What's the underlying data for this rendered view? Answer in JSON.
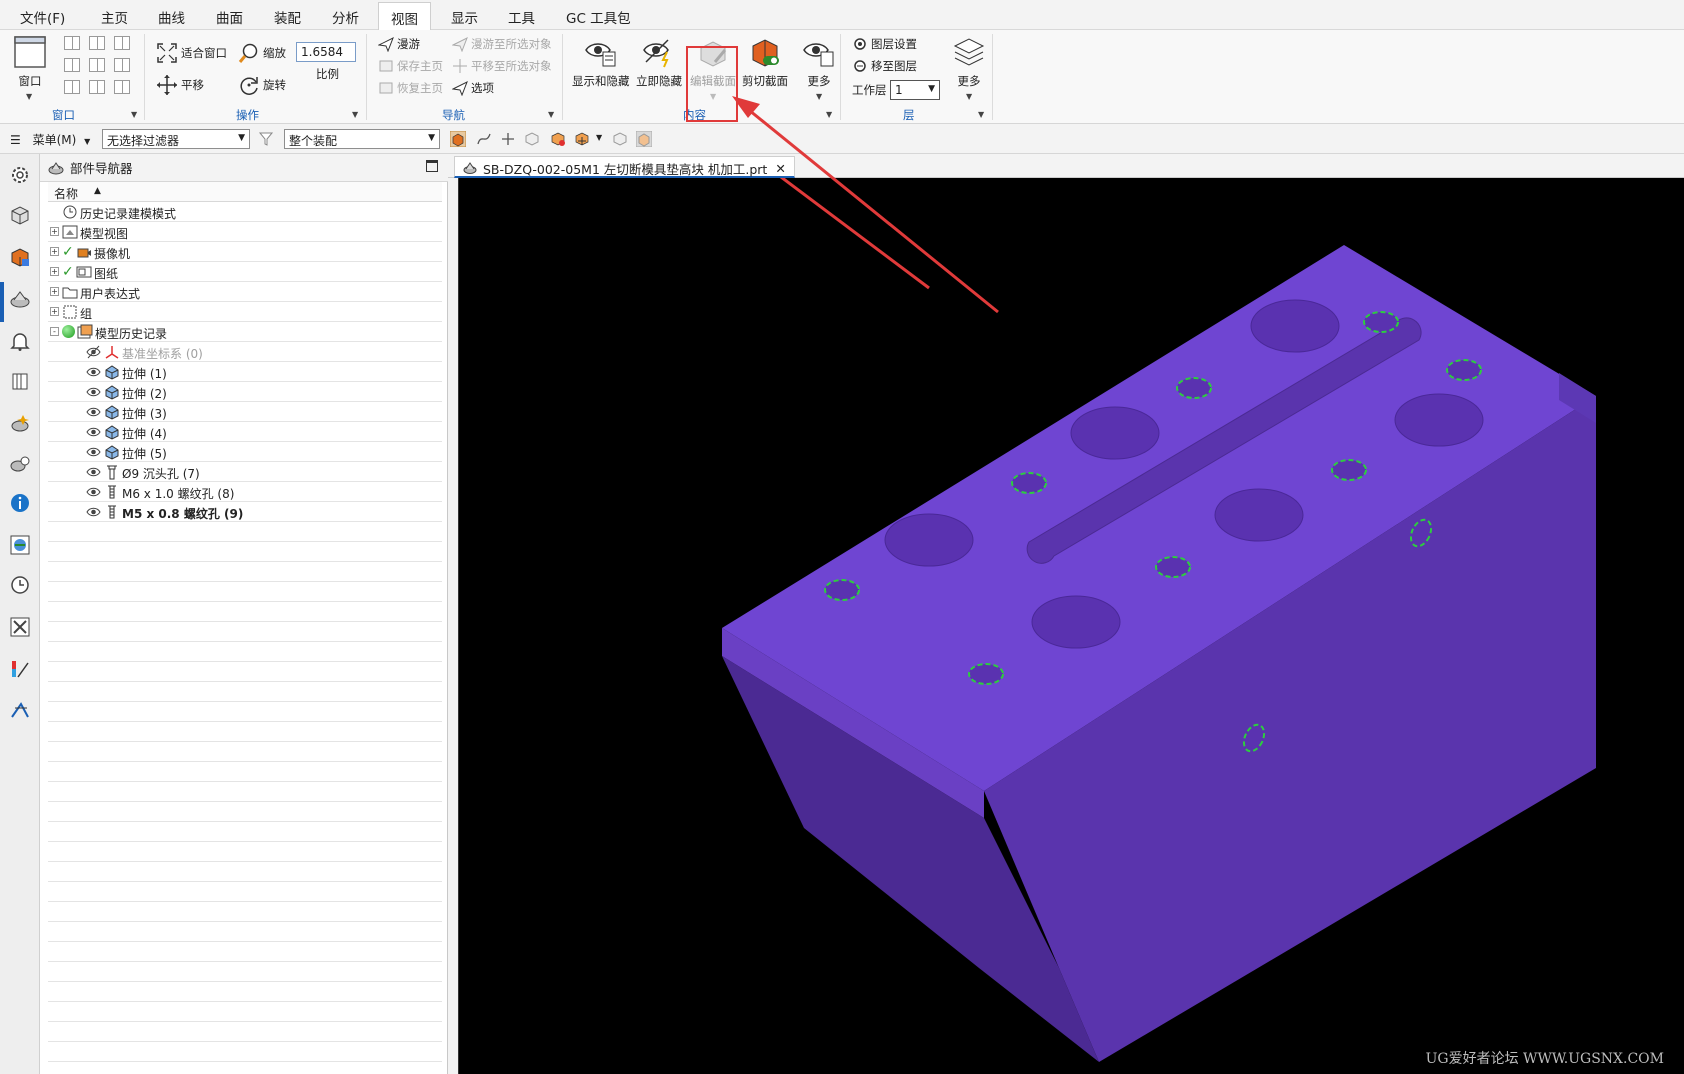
{
  "menu": {
    "tabs": [
      "文件(F)",
      "主页",
      "曲线",
      "曲面",
      "装配",
      "分析",
      "视图",
      "显示",
      "工具",
      "GC 工具包"
    ],
    "active_tab": "视图"
  },
  "ribbon": {
    "window_group": {
      "label": "窗口",
      "big_button": "窗口"
    },
    "operation_group": {
      "label": "操作",
      "fit_window": "适合窗口",
      "zoom": "缩放",
      "pan": "平移",
      "rotate": "旋转",
      "scale_value": "1.6584",
      "scale_label": "比例"
    },
    "navigation_group": {
      "label": "导航",
      "fly": "漫游",
      "fly_to_selected": "漫游至所选对象",
      "save_home": "保存主页",
      "pan_to_selected": "平移至所选对象",
      "restore_home": "恢复主页",
      "options": "选项"
    },
    "content_group": {
      "label": "内容",
      "show_hide": "显示和隐藏",
      "hide_now": "立即隐藏",
      "edit_section": "编辑截面",
      "clip_section": "剪切截面",
      "more": "更多"
    },
    "layer_group": {
      "label": "层",
      "layer_settings": "图层设置",
      "move_to_layer": "移至图层",
      "work_layer_label": "工作层",
      "work_layer_value": "1",
      "more": "更多"
    }
  },
  "selection_bar": {
    "menu_label": "菜单(M)",
    "filter": "无选择过滤器",
    "scope": "整个装配"
  },
  "navigator": {
    "title": "部件导航器",
    "column_name": "名称",
    "rows": [
      {
        "label": "历史记录建模模式",
        "indent": 0,
        "expand": "",
        "check": false
      },
      {
        "label": "模型视图",
        "indent": 0,
        "expand": "+",
        "check": false
      },
      {
        "label": "摄像机",
        "indent": 0,
        "expand": "+",
        "check": true
      },
      {
        "label": "图纸",
        "indent": 0,
        "expand": "+",
        "check": true
      },
      {
        "label": "用户表达式",
        "indent": 0,
        "expand": "+",
        "check": false
      },
      {
        "label": "组",
        "indent": 0,
        "expand": "+",
        "check": false
      },
      {
        "label": "模型历史记录",
        "indent": 0,
        "expand": "-",
        "check": false
      },
      {
        "label": "基准坐标系 (0)",
        "indent": 1,
        "dim": true
      },
      {
        "label": "拉伸 (1)",
        "indent": 1
      },
      {
        "label": "拉伸 (2)",
        "indent": 1
      },
      {
        "label": "拉伸 (3)",
        "indent": 1
      },
      {
        "label": "拉伸 (4)",
        "indent": 1
      },
      {
        "label": "拉伸 (5)",
        "indent": 1
      },
      {
        "label": "Ø9 沉头孔 (7)",
        "indent": 1
      },
      {
        "label": "M6 x 1.0 螺纹孔 (8)",
        "indent": 1
      },
      {
        "label": "M5 x 0.8 螺纹孔 (9)",
        "indent": 1,
        "bold": true
      }
    ]
  },
  "document": {
    "tab_title": "SB-DZQ-002-05M1 左切断模具垫高块 机加工.prt",
    "close": "✕"
  },
  "viewport": {
    "background": "#000000",
    "model_color": "#6f45d2",
    "watermark": "UG爱好者论坛 WWW.UGSNX.COM"
  },
  "colors": {
    "accent": "#1a5fb4",
    "highlight_box": "#e03a3a",
    "hole_marker": "#2ecc40"
  }
}
